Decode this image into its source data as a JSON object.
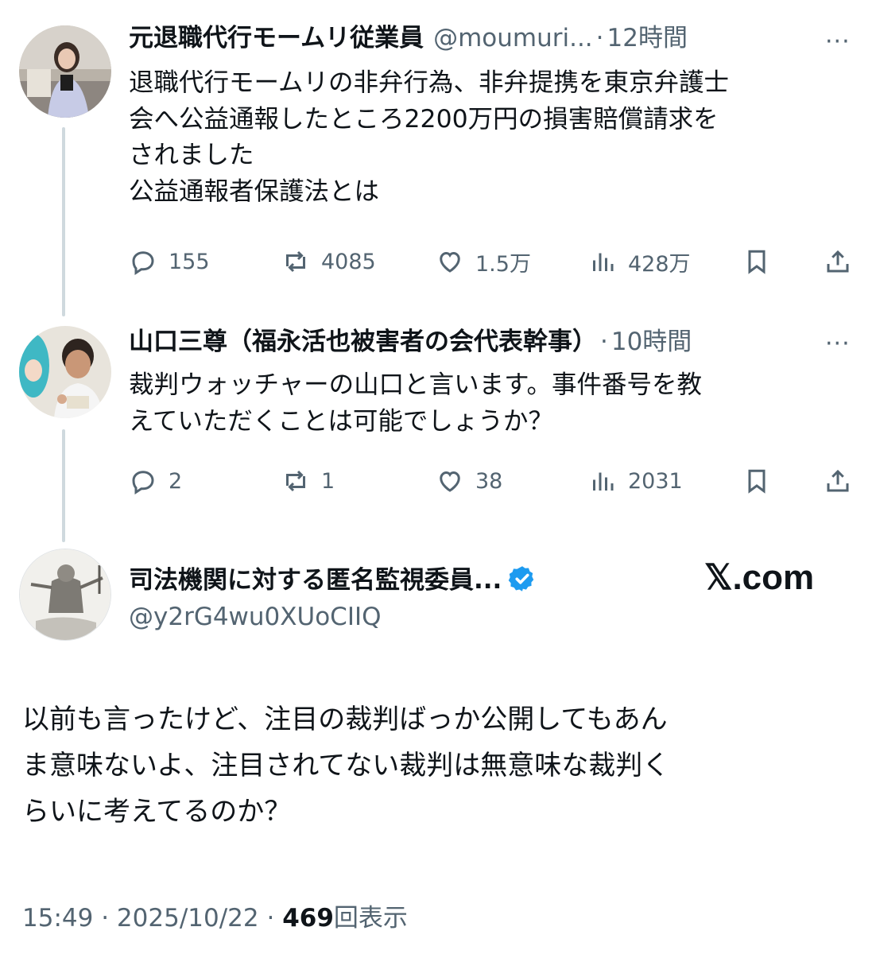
{
  "tweet1": {
    "name": "元退職代行モームリ従業員",
    "handle": "@moumuri...",
    "time": "12時間",
    "text": "退職代行モームリの非弁行為、非弁提携を東京弁護士\n会へ公益通報したところ2200万円の損害賠償請求を\nされました\n公益通報者保護法とは",
    "more": "···",
    "replies": "155",
    "reposts": "4085",
    "likes": "1.5万",
    "views": "428万"
  },
  "tweet2": {
    "name": "山口三尊（福永活也被害者の会代表幹事）",
    "time": "10時間",
    "text": "裁判ウォッチャーの山口と言います。事件番号を教\nえていただくことは可能でしょうか？",
    "more": "···",
    "replies": "2",
    "reposts": "1",
    "likes": "38",
    "views": "2031"
  },
  "tweet3": {
    "name": "司法機関に対する匿名監視委員...",
    "handle": "@y2rG4wu0XUoCIIQ",
    "verified": true,
    "text": "以前も言ったけど、注目の裁判ばっか公開してもあん\nま意味ないよ、注目されてない裁判は無意味な裁判く\nらいに考えてるのか？"
  },
  "site": "𝕏.com",
  "footer": {
    "time": "15:49",
    "date": "2025/10/22",
    "views": "469",
    "views_label": "回表示",
    "sep": "·"
  },
  "colors": {
    "text": "#0f1419",
    "secondary": "#536471",
    "thread_line": "#cfd9de",
    "verified": "#1d9bf0"
  }
}
